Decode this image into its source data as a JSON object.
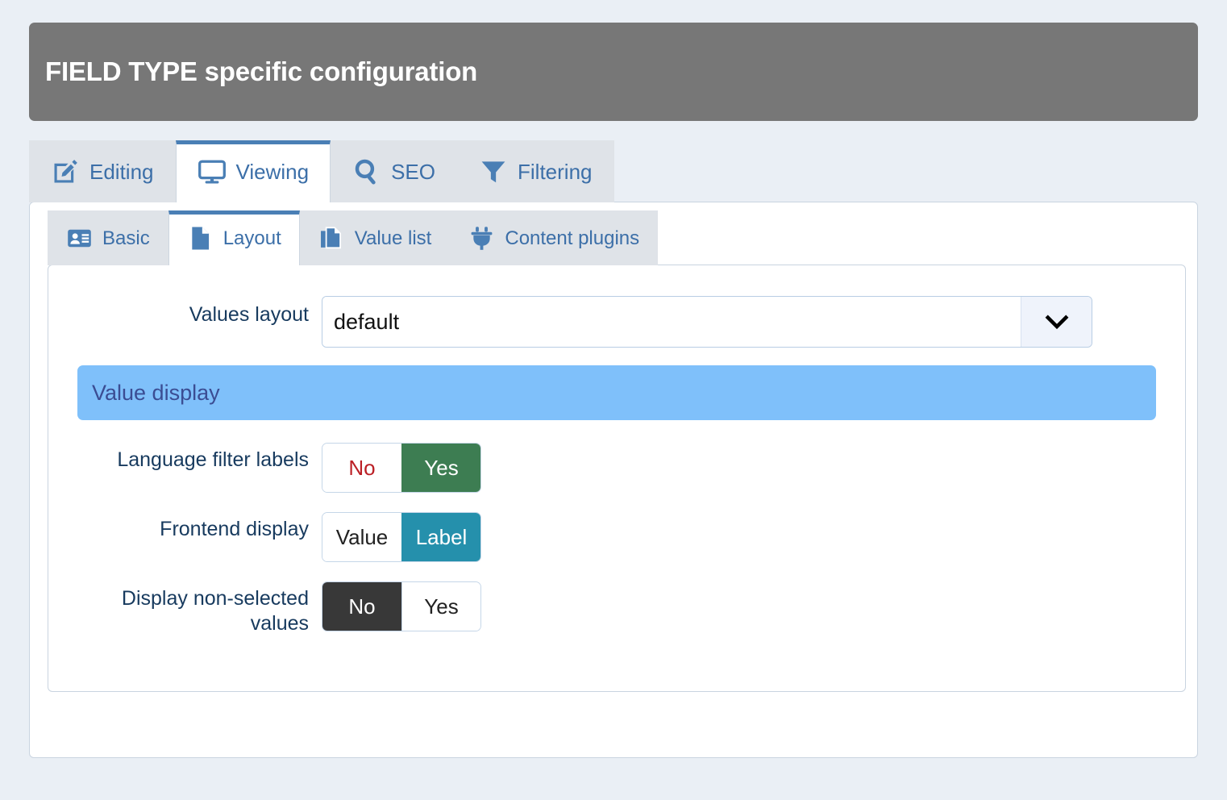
{
  "header": {
    "title": "FIELD TYPE specific configuration"
  },
  "outer_tabs": [
    {
      "label": "Editing",
      "icon": "edit-square-icon",
      "active": false
    },
    {
      "label": "Viewing",
      "icon": "monitor-icon",
      "active": true
    },
    {
      "label": "SEO",
      "icon": "search-icon",
      "active": false
    },
    {
      "label": "Filtering",
      "icon": "funnel-icon",
      "active": false
    }
  ],
  "inner_tabs": [
    {
      "label": "Basic",
      "icon": "id-card-icon",
      "active": false
    },
    {
      "label": "Layout",
      "icon": "document-icon",
      "active": true
    },
    {
      "label": "Value list",
      "icon": "copy-files-icon",
      "active": false
    },
    {
      "label": "Content plugins",
      "icon": "plug-icon",
      "active": false
    }
  ],
  "form": {
    "values_layout": {
      "label": "Values layout",
      "value": "default",
      "placeholder": "default",
      "arrow_icon": "chevron-down-icon"
    },
    "section_value_display": "Value display",
    "toggles": [
      {
        "label": "Language filter labels",
        "options": [
          {
            "text": "No",
            "state": "inactive-negative"
          },
          {
            "text": "Yes",
            "state": "active-green"
          }
        ]
      },
      {
        "label": "Frontend display",
        "options": [
          {
            "text": "Value",
            "state": "inactive"
          },
          {
            "text": "Label",
            "state": "active-teal"
          }
        ]
      },
      {
        "label": "Display non-selected values",
        "options": [
          {
            "text": "No",
            "state": "active-dark"
          },
          {
            "text": "Yes",
            "state": "inactive"
          }
        ]
      }
    ]
  },
  "colors": {
    "page_background": "#eaeff5",
    "header_background": "#777777",
    "tab_text": "#3c6fa8",
    "active_tab_border": "#4a7fb5",
    "label_text": "#173a5e",
    "section_banner": "#7fc0fa",
    "section_banner_text": "#3b4d93",
    "toggle_green": "#3d7d52",
    "toggle_teal": "#2590ac",
    "toggle_dark": "#383838",
    "toggle_negative_text": "#bb1f25"
  }
}
